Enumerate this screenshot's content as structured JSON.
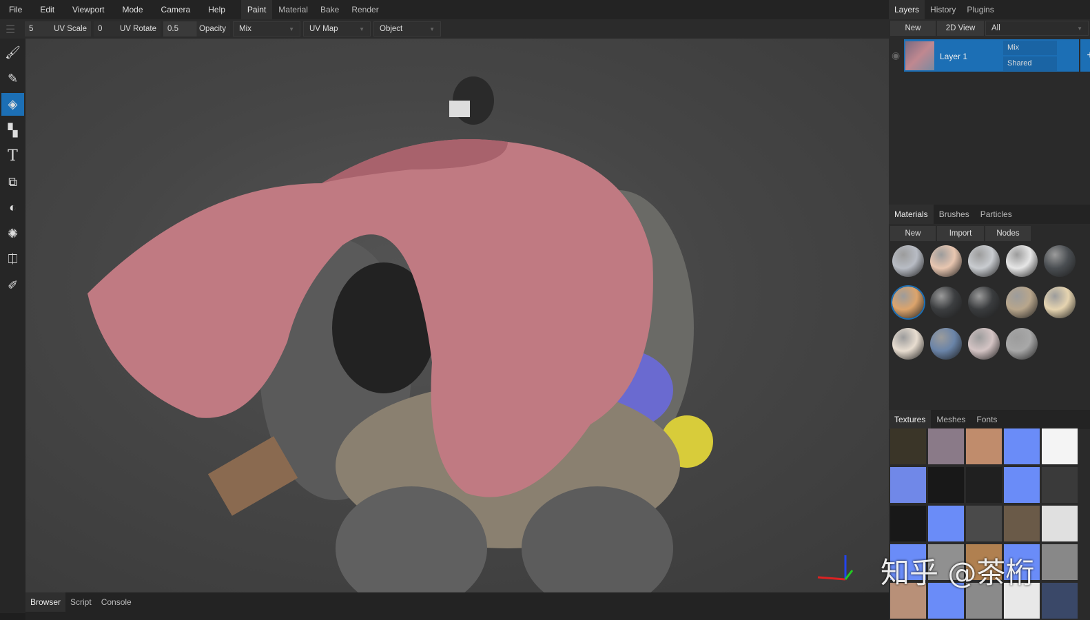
{
  "menu": [
    "File",
    "Edit",
    "Viewport",
    "Mode",
    "Camera",
    "Help"
  ],
  "workspace_tabs": [
    "Paint",
    "Material",
    "Bake",
    "Render"
  ],
  "toolbar": {
    "uv_scale_value": "5",
    "uv_scale_label": "UV Scale",
    "uv_rotate_value": "0",
    "uv_rotate_label": "UV Rotate",
    "opacity_value": "0.5",
    "opacity_label": "Opacity",
    "blend": "Mix",
    "uv_map": "UV Map",
    "target": "Object"
  },
  "tools": [
    "brush",
    "eraser",
    "fill",
    "decal",
    "text",
    "clone",
    "blur",
    "particle",
    "picker-id",
    "color-picker"
  ],
  "bottom_tabs": [
    "Browser",
    "Script",
    "Console"
  ],
  "layers": {
    "tabs": [
      "Layers",
      "History",
      "Plugins"
    ],
    "new": "New",
    "view2d": "2D View",
    "filter": "All",
    "layer_name": "Layer 1",
    "blend": "Mix",
    "mode": "Shared",
    "add": "+"
  },
  "materials": {
    "tabs": [
      "Materials",
      "Brushes",
      "Particles"
    ],
    "new": "New",
    "import": "Import",
    "nodes": "Nodes",
    "balls": [
      "#b8bcc4",
      "#e8c6b0",
      "#c9ccd0",
      "#e6e6e6",
      "#4a4e52",
      "#dca46c",
      "#3c3e40",
      "#3a3c3e",
      "#b8a68c",
      "#e6d4b0",
      "#e8ddd0",
      "#6a84a8",
      "#d4c4c4",
      "#a8a8a8"
    ],
    "selected": 5
  },
  "textures": {
    "tabs": [
      "Textures",
      "Meshes",
      "Fonts"
    ],
    "tiles": [
      "#3a3528",
      "#8a7a88",
      "#c08c6c",
      "#6a8cf8",
      "#f4f4f4",
      "#7088e8",
      "#181818",
      "#202020",
      "#6a8cf8",
      "#3a3a3a",
      "#181818",
      "#6a8cf8",
      "#4a4a4a",
      "#6a5a48",
      "#e0e0e0",
      "#6a8cf8",
      "#909090",
      "#b08050",
      "#6a8cf8",
      "#888888",
      "#b89078",
      "#6a8cf8",
      "#8a8a8a",
      "#e8e8e8",
      "#3a4868"
    ]
  },
  "watermark": "知乎 @茶桁"
}
